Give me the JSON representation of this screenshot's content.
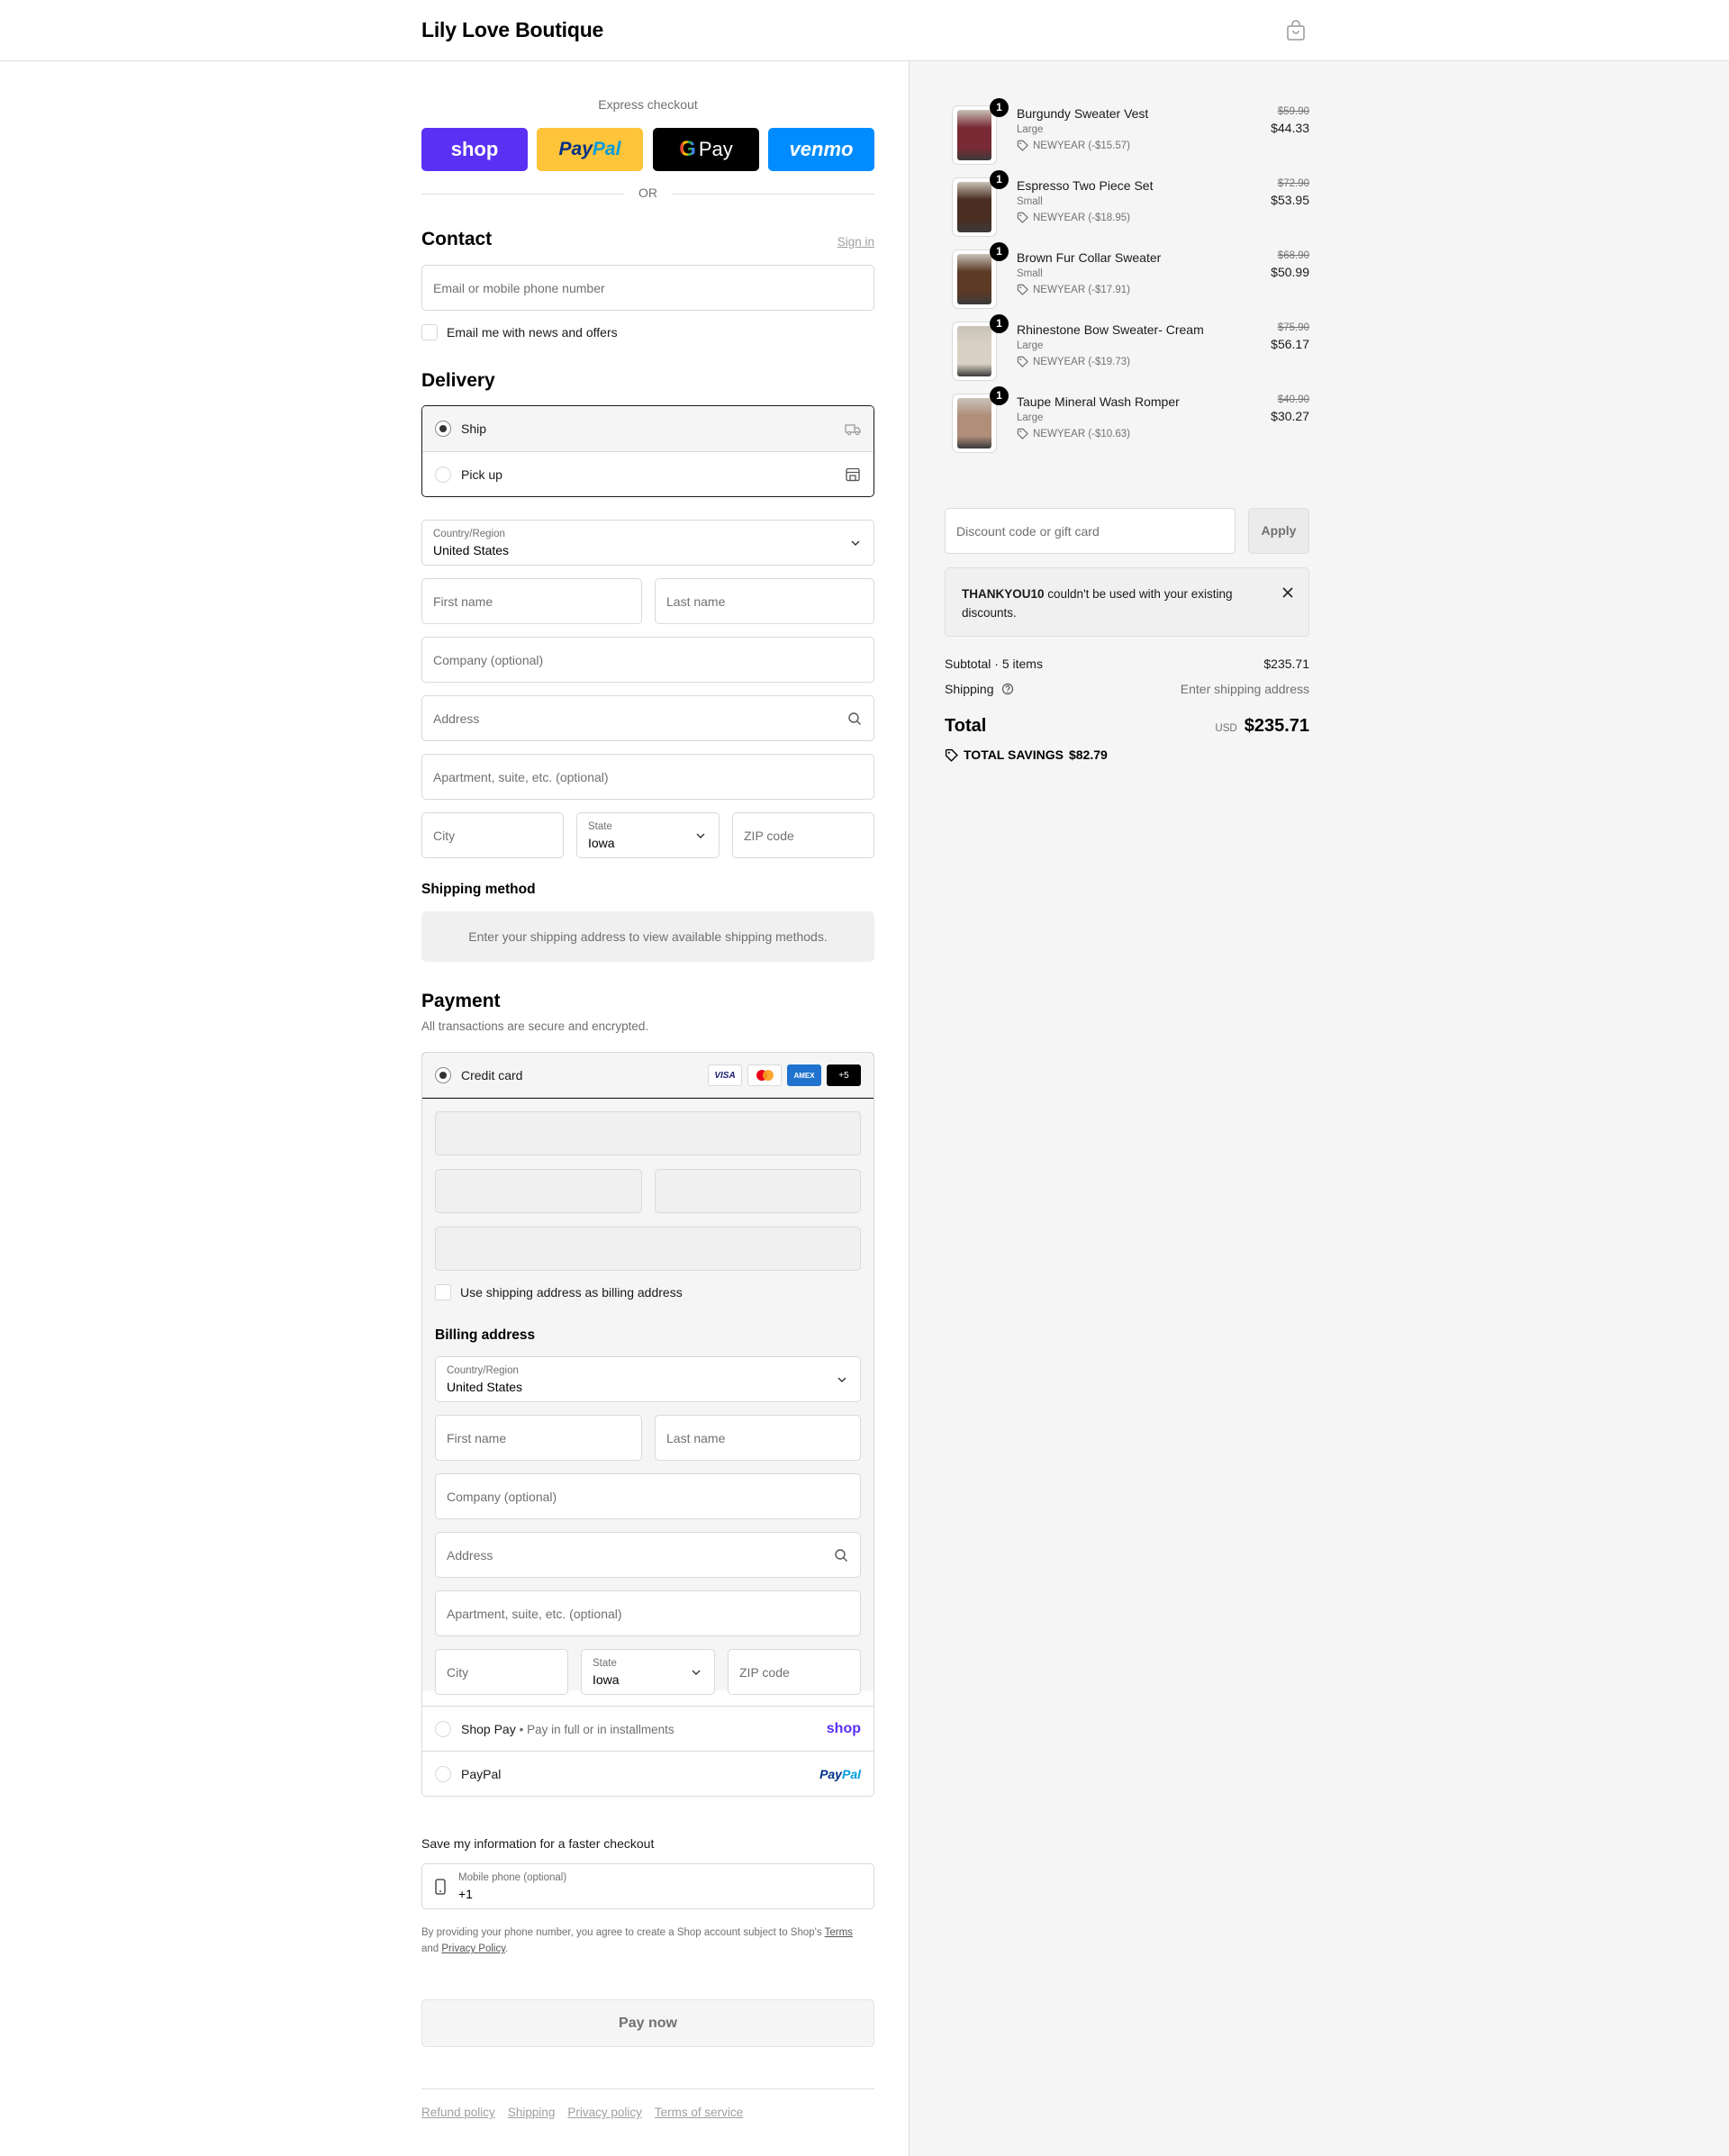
{
  "header": {
    "brand": "Lily Love Boutique",
    "cart_icon": "bag-icon"
  },
  "express": {
    "label": "Express checkout",
    "buttons": {
      "shop": "shop",
      "paypal_a": "Pay",
      "paypal_b": "Pal",
      "gpay": "Pay",
      "venmo": "venmo"
    },
    "or": "OR"
  },
  "contact": {
    "title": "Contact",
    "sign_in": "Sign in",
    "email_placeholder": "Email or mobile phone number",
    "news_label": "Email me with news and offers"
  },
  "delivery": {
    "title": "Delivery",
    "options": [
      {
        "label": "Ship",
        "selected": true,
        "icon": "truck-icon"
      },
      {
        "label": "Pick up",
        "selected": false,
        "icon": "store-icon"
      }
    ],
    "country_label": "Country/Region",
    "country_value": "United States",
    "first_name": "First name",
    "last_name": "Last name",
    "company": "Company (optional)",
    "address": "Address",
    "apartment": "Apartment, suite, etc. (optional)",
    "city": "City",
    "state_label": "State",
    "state_value": "Iowa",
    "zip": "ZIP code"
  },
  "shipping_method": {
    "title": "Shipping method",
    "note": "Enter your shipping address to view available shipping methods."
  },
  "payment": {
    "title": "Payment",
    "subtitle": "All transactions are secure and encrypted.",
    "credit_card_label": "Credit card",
    "card_logos": {
      "visa": "VISA",
      "amex": "AMEX",
      "more": "+5"
    },
    "use_shipping_label": "Use shipping address as billing address",
    "billing_title": "Billing address",
    "billing": {
      "country_label": "Country/Region",
      "country_value": "United States",
      "first_name": "First name",
      "last_name": "Last name",
      "company": "Company (optional)",
      "address": "Address",
      "apartment": "Apartment, suite, etc. (optional)",
      "city": "City",
      "state_label": "State",
      "state_value": "Iowa",
      "zip": "ZIP code"
    },
    "shop_pay_label": "Shop Pay",
    "shop_pay_sub": "Pay in full or in installments",
    "shop_pay_logo": "shop",
    "paypal_label": "PayPal",
    "paypal_logo_a": "Pay",
    "paypal_logo_b": "Pal"
  },
  "save_info": {
    "title": "Save my information for a faster checkout",
    "phone_label": "Mobile phone (optional)",
    "phone_value": "+1",
    "legal_prefix": "By providing your phone number, you agree to create a Shop account subject to Shop's",
    "terms": "Terms",
    "and": "and",
    "privacy": "Privacy Policy",
    "period": "."
  },
  "pay_now": "Pay now",
  "footer": {
    "links": [
      "Refund policy",
      "Shipping",
      "Privacy policy",
      "Terms of service"
    ]
  },
  "summary": {
    "items": [
      {
        "qty": "1",
        "name": "Burgundy Sweater Vest",
        "variant": "Large",
        "discount": "NEWYEAR (-$15.57)",
        "original": "$59.90",
        "price": "$44.33",
        "thumb_color": "#7a2a35"
      },
      {
        "qty": "1",
        "name": "Espresso Two Piece Set",
        "variant": "Small",
        "discount": "NEWYEAR (-$18.95)",
        "original": "$72.90",
        "price": "$53.95",
        "thumb_color": "#4a2e22"
      },
      {
        "qty": "1",
        "name": "Brown Fur Collar Sweater",
        "variant": "Small",
        "discount": "NEWYEAR (-$17.91)",
        "original": "$68.90",
        "price": "$50.99",
        "thumb_color": "#5c3a26"
      },
      {
        "qty": "1",
        "name": "Rhinestone Bow Sweater- Cream",
        "variant": "Large",
        "discount": "NEWYEAR (-$19.73)",
        "original": "$75.90",
        "price": "$56.17",
        "thumb_color": "#d8d0c4"
      },
      {
        "qty": "1",
        "name": "Taupe Mineral Wash Romper",
        "variant": "Large",
        "discount": "NEWYEAR (-$10.63)",
        "original": "$40.90",
        "price": "$30.27",
        "thumb_color": "#b08e7a"
      }
    ],
    "discount_placeholder": "Discount code or gift card",
    "apply": "Apply",
    "notice_code": "THANKYOU10",
    "notice_text": "couldn't be used with your existing discounts.",
    "subtotal_label": "Subtotal · 5 items",
    "subtotal_value": "$235.71",
    "shipping_label": "Shipping",
    "shipping_value": "Enter shipping address",
    "total_label": "Total",
    "currency": "USD",
    "total_value": "$235.71",
    "savings_label": "TOTAL SAVINGS",
    "savings_value": "$82.79"
  }
}
